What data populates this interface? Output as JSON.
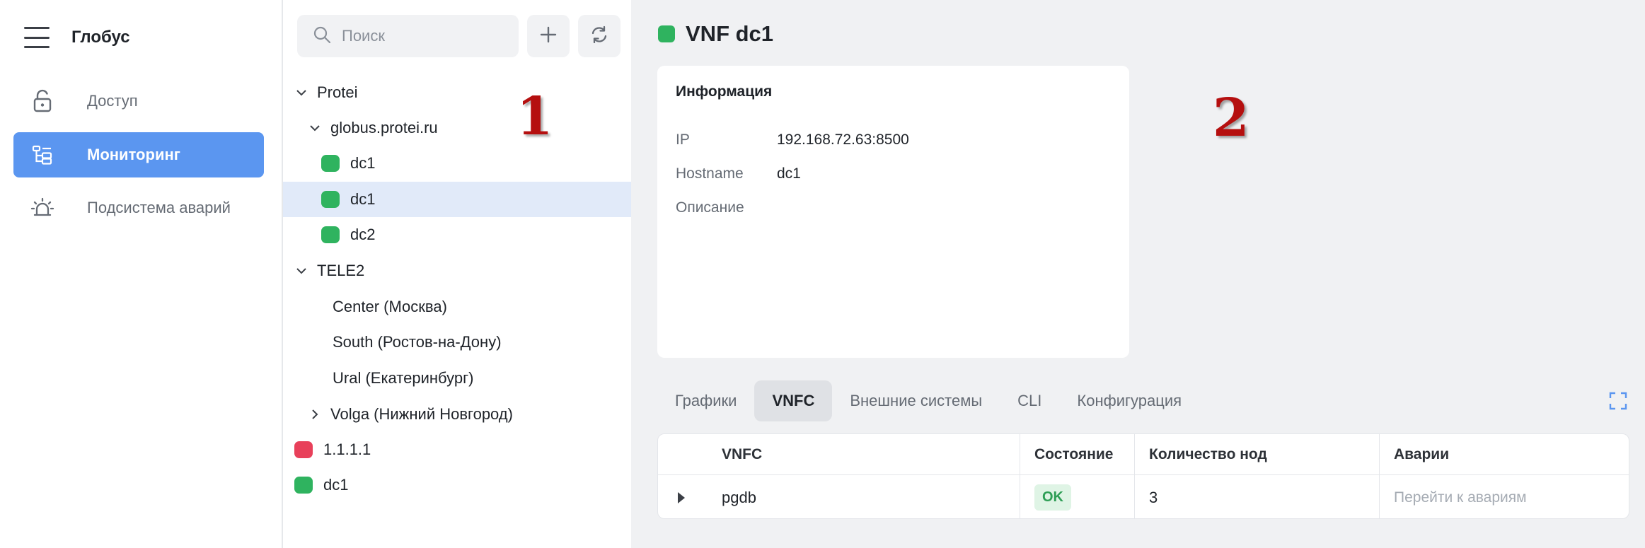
{
  "app": {
    "title": "Глобус"
  },
  "nav": {
    "items": [
      {
        "label": "Доступ",
        "icon": "unlock-icon",
        "active": false
      },
      {
        "label": "Мониторинг",
        "icon": "tree-structure-icon",
        "active": true
      },
      {
        "label": "Подсистема аварий",
        "icon": "alarm-siren-icon",
        "active": false
      }
    ]
  },
  "tree": {
    "search_placeholder": "Поиск",
    "add_icon": "plus-icon",
    "refresh_icon": "refresh-icon",
    "nodes": [
      {
        "label": "Protei",
        "level": 0,
        "expander": "expanded"
      },
      {
        "label": "globus.protei.ru",
        "level": 1,
        "expander": "expanded"
      },
      {
        "label": "dc1",
        "level": 2,
        "status": "green"
      },
      {
        "label": "dc1",
        "level": 2,
        "status": "green",
        "selected": true
      },
      {
        "label": "dc2",
        "level": 2,
        "status": "green"
      },
      {
        "label": "TELE2",
        "level": 0,
        "expander": "expanded"
      },
      {
        "label": "Center (Москва)",
        "level": 1
      },
      {
        "label": "South (Ростов-на-Дону)",
        "level": 1
      },
      {
        "label": "Ural (Екатеринбург)",
        "level": 1
      },
      {
        "label": "Volga (Нижний Новгород)",
        "level": 1,
        "expander": "collapsed"
      },
      {
        "label": "1.1.1.1",
        "level": 0,
        "status": "red"
      },
      {
        "label": "dc1",
        "level": 0,
        "status": "green"
      }
    ]
  },
  "annotations": {
    "marker_1": "1",
    "marker_2": "2"
  },
  "main": {
    "title": "VNF dc1",
    "title_status": "green",
    "info": {
      "title": "Информация",
      "rows": [
        {
          "key": "IP",
          "value": "192.168.72.63:8500"
        },
        {
          "key": "Hostname",
          "value": "dc1"
        },
        {
          "key": "Описание",
          "value": ""
        }
      ]
    },
    "tabs": [
      {
        "label": "Графики",
        "active": false
      },
      {
        "label": "VNFC",
        "active": true
      },
      {
        "label": "Внешние системы",
        "active": false
      },
      {
        "label": "CLI",
        "active": false
      },
      {
        "label": "Конфигурация",
        "active": false
      }
    ],
    "expand_icon": "fullscreen-icon",
    "table": {
      "columns": [
        "VNFC",
        "Состояние",
        "Количество нод",
        "Аварии"
      ],
      "rows": [
        {
          "vnfc": "pgdb",
          "state": "OK",
          "nodes": "3",
          "alarms_link": "Перейти к авариям"
        }
      ]
    }
  },
  "colors": {
    "accent": "#5b96f0",
    "status_green": "#2fb35f",
    "status_red": "#e8405a",
    "selected_row": "#e1eaf9",
    "badge_ok_bg": "#dff4e5",
    "badge_ok_text": "#2e9e55",
    "marker": "#b50f0f"
  }
}
